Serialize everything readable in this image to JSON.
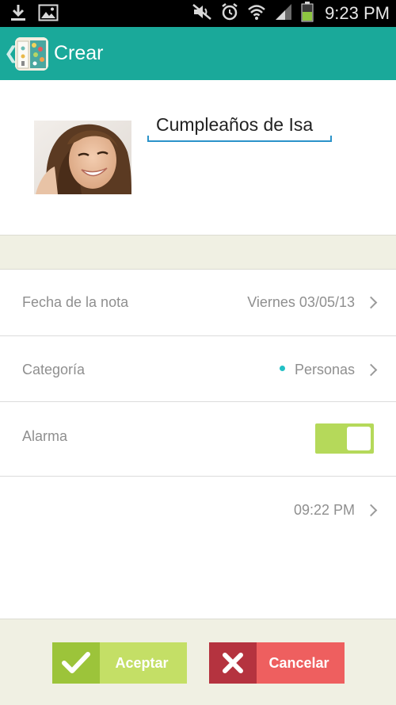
{
  "status_bar": {
    "time": "9:23 PM",
    "icons": [
      "download-icon",
      "image-icon",
      "mute-icon",
      "alarm-clock-icon",
      "wifi-icon",
      "signal-icon",
      "battery-icon"
    ]
  },
  "app_bar": {
    "title": "Crear",
    "color": "#1aa99a"
  },
  "note": {
    "title_value": "Cumpleaños de Isa"
  },
  "fields": {
    "date": {
      "label": "Fecha de la nota",
      "value": "Viernes 03/05/13"
    },
    "category": {
      "label": "Categoría",
      "value": "Personas",
      "dot_color": "#22c0c5"
    },
    "alarm": {
      "label": "Alarma",
      "enabled": true
    },
    "time": {
      "value": "09:22 PM"
    }
  },
  "actions": {
    "accept_label": "Aceptar",
    "cancel_label": "Cancelar",
    "accept_color": "#c4df66",
    "cancel_color": "#ee5f5f"
  }
}
